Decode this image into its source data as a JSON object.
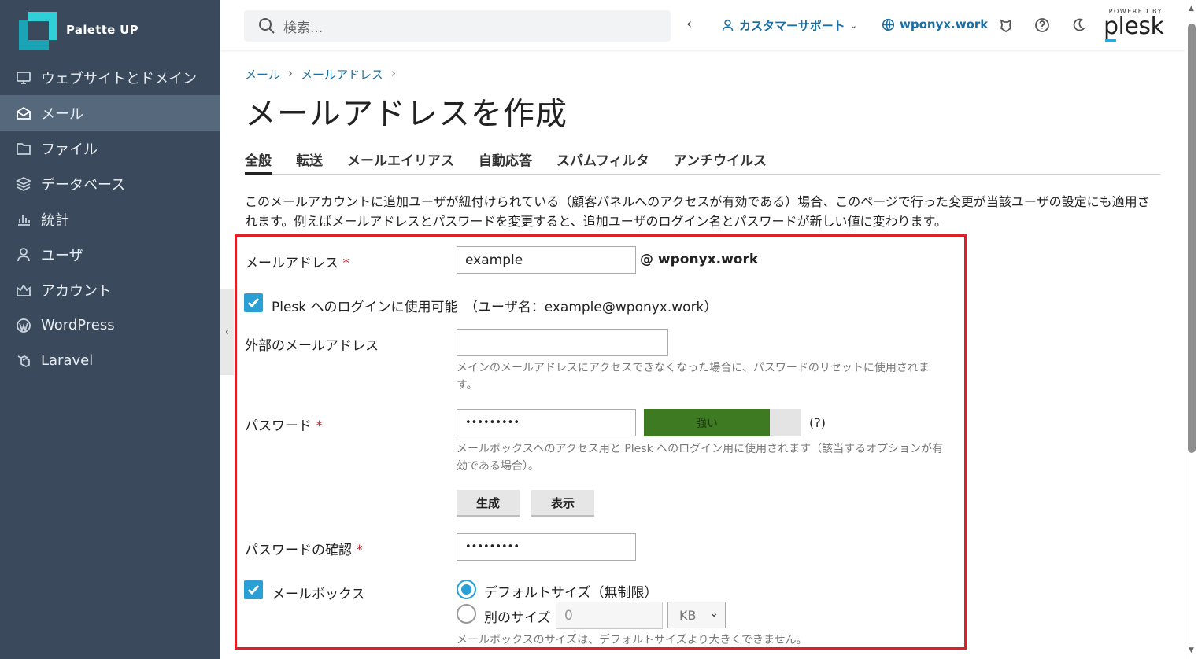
{
  "brand": {
    "name": "Palette UP"
  },
  "sidebar": {
    "items": [
      {
        "label": "ウェブサイトとドメイン",
        "icon": "monitor-icon"
      },
      {
        "label": "メール",
        "icon": "mail-icon",
        "active": true
      },
      {
        "label": "ファイル",
        "icon": "folder-icon"
      },
      {
        "label": "データベース",
        "icon": "database-icon"
      },
      {
        "label": "統計",
        "icon": "chart-icon"
      },
      {
        "label": "ユーザ",
        "icon": "user-icon"
      },
      {
        "label": "アカウント",
        "icon": "crown-icon"
      },
      {
        "label": "WordPress",
        "icon": "wordpress-icon"
      },
      {
        "label": "Laravel",
        "icon": "laravel-icon"
      }
    ]
  },
  "topbar": {
    "search_placeholder": "検索...",
    "back": "‹",
    "user": "カスタマーサポート",
    "domain": "wponyx.work",
    "powered_by": "POWERED BY",
    "plesk": "plesk"
  },
  "breadcrumb": {
    "items": [
      "メール",
      "メールアドレス"
    ],
    "sep": "›"
  },
  "page_title": "メールアドレスを作成",
  "tabs": [
    "全般",
    "転送",
    "メールエイリアス",
    "自動応答",
    "スパムフィルタ",
    "アンチウイルス"
  ],
  "description": "このメールアカウントに追加ユーザが紐付けられている（顧客パネルへのアクセスが有効である）場合、このページで行った変更が当該ユーザの設定にも適用されます。例えばメールアドレスとパスワードを変更すると、追加ユーザのログイン名とパスワードが新しい値に変わります。",
  "form": {
    "email_label": "メールアドレス",
    "required_mark": "*",
    "email_value": "example",
    "email_domain": "@ wponyx.work",
    "plesk_login_label": "Plesk へのログインに使用可能　（ユーザ名：example@wponyx.work）",
    "plesk_login_checked": true,
    "external_email_label": "外部のメールアドレス",
    "external_email_value": "",
    "external_email_hint": "メインのメールアドレスにアクセスできなくなった場合に、パスワードのリセットに使用されます。",
    "password_label": "パスワード",
    "password_value": "•••••••••",
    "strength_label": "強い",
    "strength_level": 0.8,
    "strength_color": "#3d7a22",
    "help_mark": "(?)",
    "password_hint": "メールボックスへのアクセス用と Plesk へのログイン用に使用されます（該当するオプションが有効である場合）。",
    "generate_button": "生成",
    "show_button": "表示",
    "confirm_label": "パスワードの確認",
    "confirm_value": "•••••••••",
    "mailbox_label": "メールボックス",
    "mailbox_checked": true,
    "default_size_label": "デフォルトサイズ（無制限）",
    "custom_size_label": "別のサイズ",
    "custom_size_value": "0",
    "unit_value": "KB",
    "mailbox_hint": "メールボックスのサイズは、デフォルトサイズより大きくできません。"
  },
  "colors": {
    "sidebar_bg": "#3a4a5c",
    "accent": "#2a9fd6",
    "link": "#1c6fa3",
    "highlight_box": "#e01f26"
  }
}
